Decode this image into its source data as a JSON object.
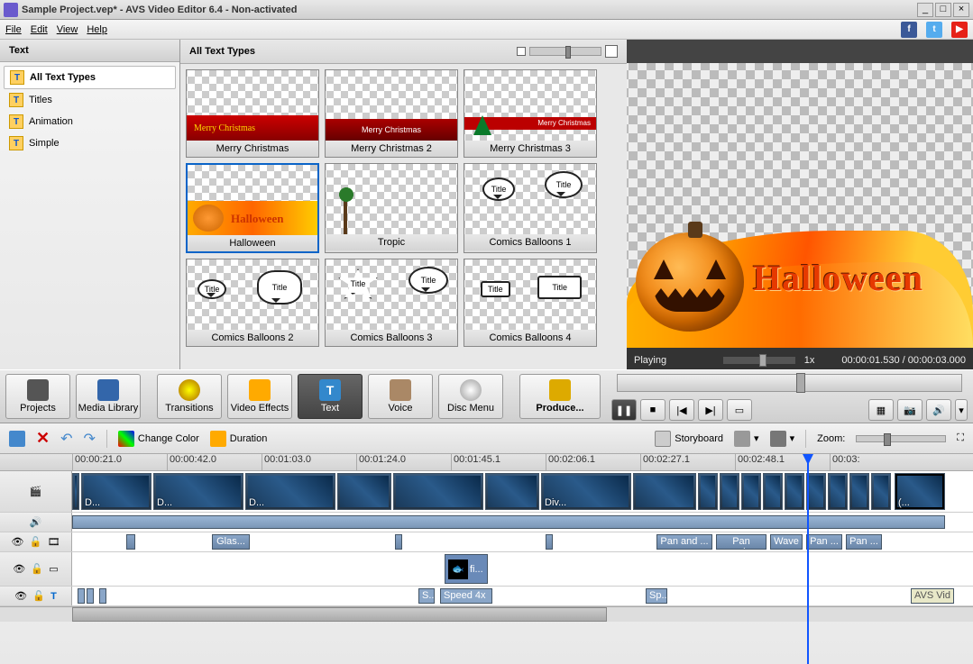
{
  "window": {
    "title": "Sample Project.vep* - AVS Video Editor 6.4 - Non-activated"
  },
  "menu": {
    "file": "File",
    "edit": "Edit",
    "view": "View",
    "help": "Help"
  },
  "leftpanel": {
    "header": "Text",
    "cats": [
      "All Text Types",
      "Titles",
      "Animation",
      "Simple"
    ]
  },
  "midpanel": {
    "header": "All Text Types",
    "thumbs": [
      "Merry Christmas",
      "Merry Christmas 2",
      "Merry Christmas 3",
      "Halloween",
      "Tropic",
      "Comics Balloons 1",
      "Comics Balloons 2",
      "Comics Balloons 3",
      "Comics Balloons 4"
    ]
  },
  "preview": {
    "status": "Playing",
    "speed": "1x",
    "cur": "00:00:01.530",
    "sep": "/",
    "total": "00:00:03.000",
    "text": "Halloween"
  },
  "toolbar": {
    "projects": "Projects",
    "media": "Media Library",
    "trans": "Transitions",
    "fx": "Video Effects",
    "text": "Text",
    "voice": "Voice",
    "disc": "Disc Menu",
    "produce": "Produce..."
  },
  "edittb": {
    "changecolor": "Change Color",
    "duration": "Duration",
    "storyboard": "Storyboard",
    "zoom": "Zoom:"
  },
  "ruler": [
    "00:00:21.0",
    "00:00:42.0",
    "00:01:03.0",
    "00:01:24.0",
    "00:01:45.1",
    "00:02:06.1",
    "00:02:27.1",
    "00:02:48.1",
    "00:03:"
  ],
  "vidclips": [
    "D...",
    "D...",
    "D...",
    "",
    "Div...",
    "",
    "",
    "",
    "",
    "",
    "",
    "",
    "(..."
  ],
  "fxclips": [
    "Glas...",
    "Pan and ...",
    "Pan and...",
    "Wave",
    "Pan ...",
    "Pan ..."
  ],
  "overlay": "fi...",
  "speedclips": [
    "S...",
    "Speed 4x",
    "Sp..."
  ],
  "watermark": "AVS Vid",
  "balloon_title": "Title"
}
